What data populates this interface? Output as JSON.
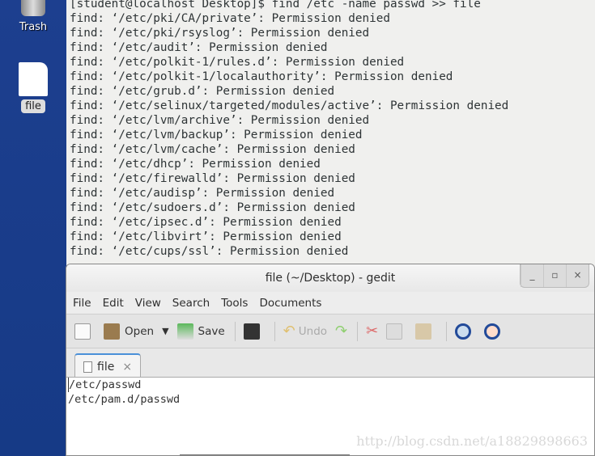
{
  "desktop": {
    "icons": [
      {
        "label": "Trash",
        "icon": "trash-icon"
      },
      {
        "label": "file",
        "icon": "file-icon"
      }
    ]
  },
  "terminal": {
    "lines": [
      "[student@localhost Desktop]$ find /etc -name passwd >> file",
      "find: ‘/etc/pki/CA/private’: Permission denied",
      "find: ‘/etc/pki/rsyslog’: Permission denied",
      "find: ‘/etc/audit’: Permission denied",
      "find: ‘/etc/polkit-1/rules.d’: Permission denied",
      "find: ‘/etc/polkit-1/localauthority’: Permission denied",
      "find: ‘/etc/grub.d’: Permission denied",
      "find: ‘/etc/selinux/targeted/modules/active’: Permission denied",
      "find: ‘/etc/lvm/archive’: Permission denied",
      "find: ‘/etc/lvm/backup’: Permission denied",
      "find: ‘/etc/lvm/cache’: Permission denied",
      "find: ‘/etc/dhcp’: Permission denied",
      "find: ‘/etc/firewalld’: Permission denied",
      "find: ‘/etc/audisp’: Permission denied",
      "find: ‘/etc/sudoers.d’: Permission denied",
      "find: ‘/etc/ipsec.d’: Permission denied",
      "find: ‘/etc/libvirt’: Permission denied",
      "find: ‘/etc/cups/ssl’: Permission denied"
    ]
  },
  "gedit": {
    "title": "file (~/Desktop) - gedit",
    "window_buttons": [
      "_",
      "▫",
      "×"
    ],
    "menu": [
      "File",
      "Edit",
      "View",
      "Search",
      "Tools",
      "Documents"
    ],
    "toolbar": {
      "open": "Open",
      "save": "Save",
      "undo": "Undo"
    },
    "tab": {
      "label": "file",
      "close": "×"
    },
    "content": [
      "/etc/passwd",
      "/etc/pam.d/passwd"
    ],
    "watermark": "http://blog.csdn.net/a18829898663"
  }
}
